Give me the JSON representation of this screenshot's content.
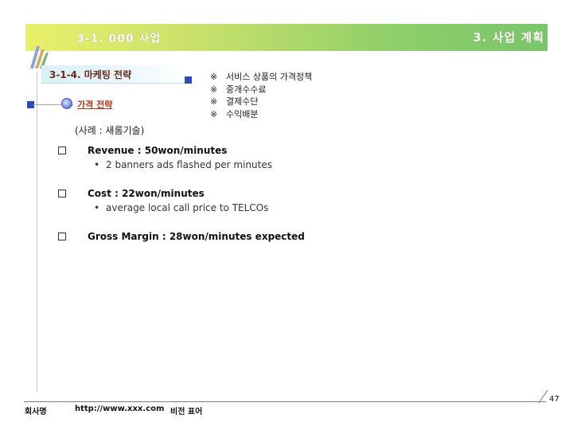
{
  "header": {
    "left_title": "3-1. 000 사업",
    "right_title": "3. 사업 계획"
  },
  "section": {
    "title": "3-1-4. 마케팅 전략",
    "strategy_label": "가격 전략"
  },
  "notes": [
    {
      "mark": "※",
      "text": "서비스 상품의 가격정책"
    },
    {
      "mark": "※",
      "text": "중개수수료"
    },
    {
      "mark": "※",
      "text": "결제수단"
    },
    {
      "mark": "※",
      "text": "수익배분"
    }
  ],
  "example": "(사례 : 새롬기술)",
  "items": [
    {
      "main": "Revenue :  50won/minutes",
      "sub_bullet": "•",
      "sub": "2 banners ads flashed per minutes"
    },
    {
      "main": "Cost : 22won/minutes",
      "sub_bullet": "•",
      "sub": "average local call price to TELCOs"
    },
    {
      "main": "Gross Margin : 28won/minutes expected"
    }
  ],
  "footer": {
    "left": "회사명",
    "url": "http://www.xxx.com",
    "middle": "비전 표어",
    "page_number": "47"
  },
  "colors": {
    "header_gradient_start": "#e9f06a",
    "header_gradient_end": "#79c56b",
    "section_title": "#6b2a1a",
    "strategy_label": "#b23b1a",
    "accent_square": "#2f4bb8"
  }
}
